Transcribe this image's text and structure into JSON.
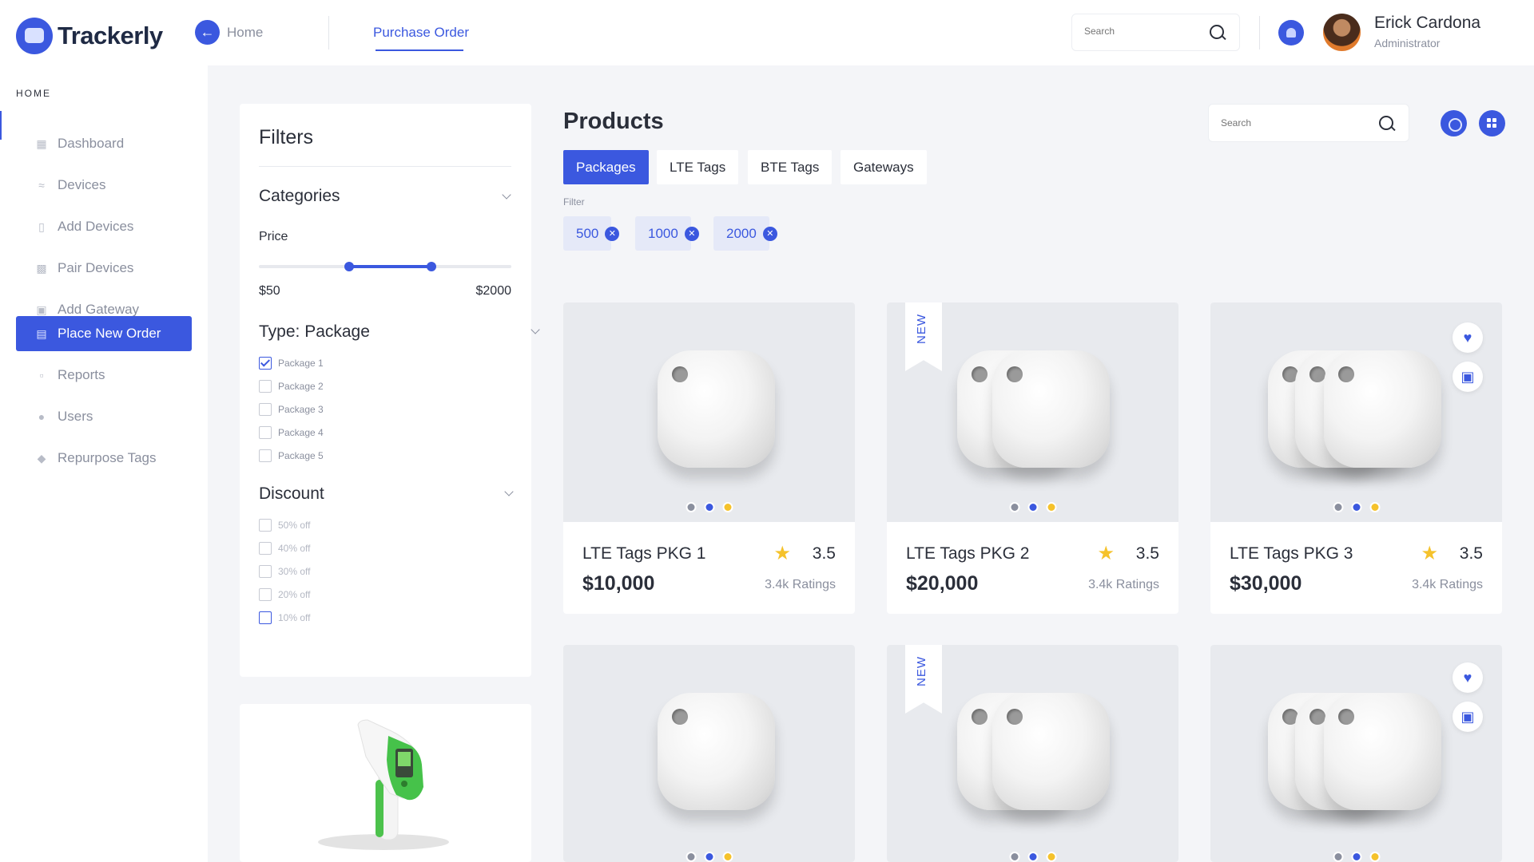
{
  "app": {
    "name": "Trackerly"
  },
  "header": {
    "home_label": "Home",
    "active_tab": "Purchase Order",
    "search_placeholder": "Search",
    "user": {
      "name": "Erick Cardona",
      "role": "Administrator"
    }
  },
  "sidebar": {
    "heading": "HOME",
    "items": [
      {
        "label": "Dashboard",
        "icon": "dashboard-icon"
      },
      {
        "label": "Devices",
        "icon": "wifi-icon"
      },
      {
        "label": "Add Devices",
        "icon": "add-device-icon"
      },
      {
        "label": "Pair Devices",
        "icon": "qr-icon"
      },
      {
        "label": "Add Gateway",
        "icon": "router-icon"
      },
      {
        "label": "Place New Order",
        "icon": "calendar-icon",
        "active": true
      },
      {
        "label": "Reports",
        "icon": "report-icon"
      },
      {
        "label": "Users",
        "icon": "users-icon"
      },
      {
        "label": "Repurpose Tags",
        "icon": "tag-icon"
      }
    ]
  },
  "filters": {
    "title": "Filters",
    "categories_title": "Categories",
    "price_label": "Price",
    "price_min": "$50",
    "price_max": "$2000",
    "type_title": "Type: Package",
    "packages": [
      {
        "label": "Package 1",
        "checked": true
      },
      {
        "label": "Package 2",
        "checked": false
      },
      {
        "label": "Package 3",
        "checked": false
      },
      {
        "label": "Package 4",
        "checked": false
      },
      {
        "label": "Package 5",
        "checked": false
      }
    ],
    "discount_title": "Discount",
    "discounts": [
      {
        "label": "50% off"
      },
      {
        "label": "40% off"
      },
      {
        "label": "30% off"
      },
      {
        "label": "20% off"
      },
      {
        "label": "10% off"
      }
    ]
  },
  "main": {
    "title": "Products",
    "search_placeholder": "Search",
    "tabs": [
      "Packages",
      "LTE Tags",
      "BTE Tags",
      "Gateways"
    ],
    "active_tab": "Packages",
    "filter_label": "Filter",
    "chips": [
      "500",
      "1000",
      "2000"
    ],
    "ribbon_label": "NEW",
    "products": [
      {
        "name": "LTE Tags PKG 1",
        "price": "$10,000",
        "rating": "3.5",
        "count": "3.4k Ratings",
        "tags": 1,
        "is_new": false,
        "actions": false
      },
      {
        "name": "LTE Tags PKG 2",
        "price": "$20,000",
        "rating": "3.5",
        "count": "3.4k Ratings",
        "tags": 2,
        "is_new": true,
        "actions": false
      },
      {
        "name": "LTE Tags PKG 3",
        "price": "$30,000",
        "rating": "3.5",
        "count": "3.4k Ratings",
        "tags": 3,
        "is_new": false,
        "actions": true
      },
      {
        "tags": 1,
        "is_new": false,
        "actions": false
      },
      {
        "tags": 2,
        "is_new": true,
        "actions": false
      },
      {
        "tags": 3,
        "is_new": false,
        "actions": true
      }
    ]
  },
  "colors": {
    "accent": "#3b58df",
    "dot_gray": "#8a8f9e",
    "dot_blue": "#3b58df",
    "dot_yellow": "#f5c22b",
    "star": "#f5c22b"
  }
}
